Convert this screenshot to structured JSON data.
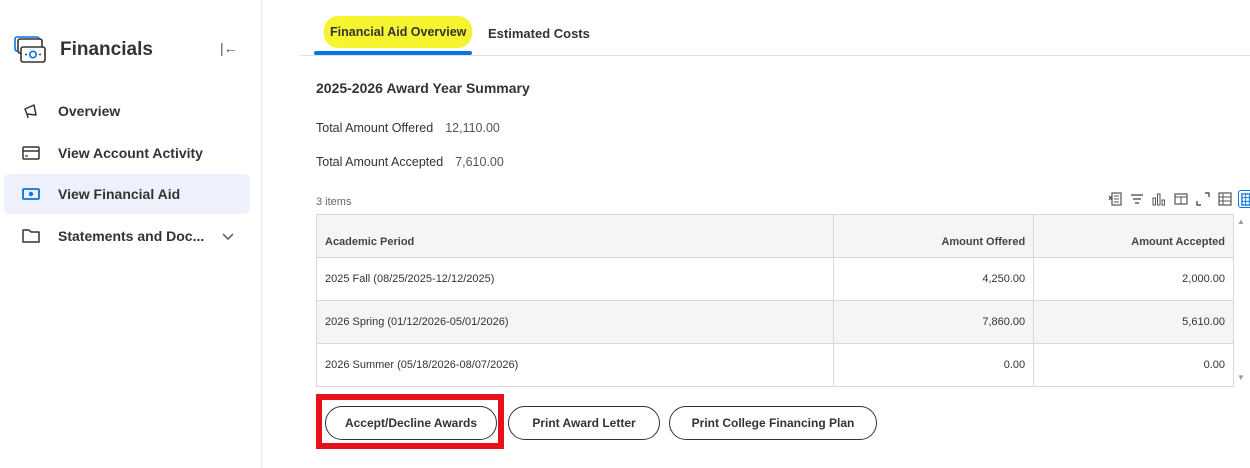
{
  "sidebar": {
    "title": "Financials",
    "collapse_glyph": "|←",
    "items": [
      {
        "label": "Overview",
        "icon": "megaphone-icon"
      },
      {
        "label": "View Account Activity",
        "icon": "card-icon"
      },
      {
        "label": "View Financial Aid",
        "icon": "money-icon"
      },
      {
        "label": "Statements and Doc...",
        "icon": "folder-icon"
      }
    ]
  },
  "tabs": {
    "active": "Financial Aid Overview",
    "second": "Estimated Costs"
  },
  "summary": {
    "title": "2025-2026 Award Year Summary",
    "offered_label": "Total Amount Offered",
    "offered_value": "12,110.00",
    "accepted_label": "Total Amount Accepted",
    "accepted_value": "7,610.00"
  },
  "grid": {
    "count_label": "3 items",
    "columns": [
      "Academic Period",
      "Amount Offered",
      "Amount Accepted"
    ],
    "rows": [
      {
        "period": "2025 Fall (08/25/2025-12/12/2025)",
        "offered": "4,250.00",
        "accepted": "2,000.00"
      },
      {
        "period": "2026 Spring (01/12/2026-05/01/2026)",
        "offered": "7,860.00",
        "accepted": "5,610.00"
      },
      {
        "period": "2026 Summer (05/18/2026-08/07/2026)",
        "offered": "0.00",
        "accepted": "0.00"
      }
    ]
  },
  "buttons": {
    "accept": "Accept/Decline Awards",
    "print_letter": "Print Award Letter",
    "print_plan": "Print College Financing Plan"
  },
  "colors": {
    "accent": "#0875e1",
    "highlight_yellow": "#f6f42f",
    "annotation_red": "#e8101b",
    "active_item_bg": "#eef0fb"
  }
}
